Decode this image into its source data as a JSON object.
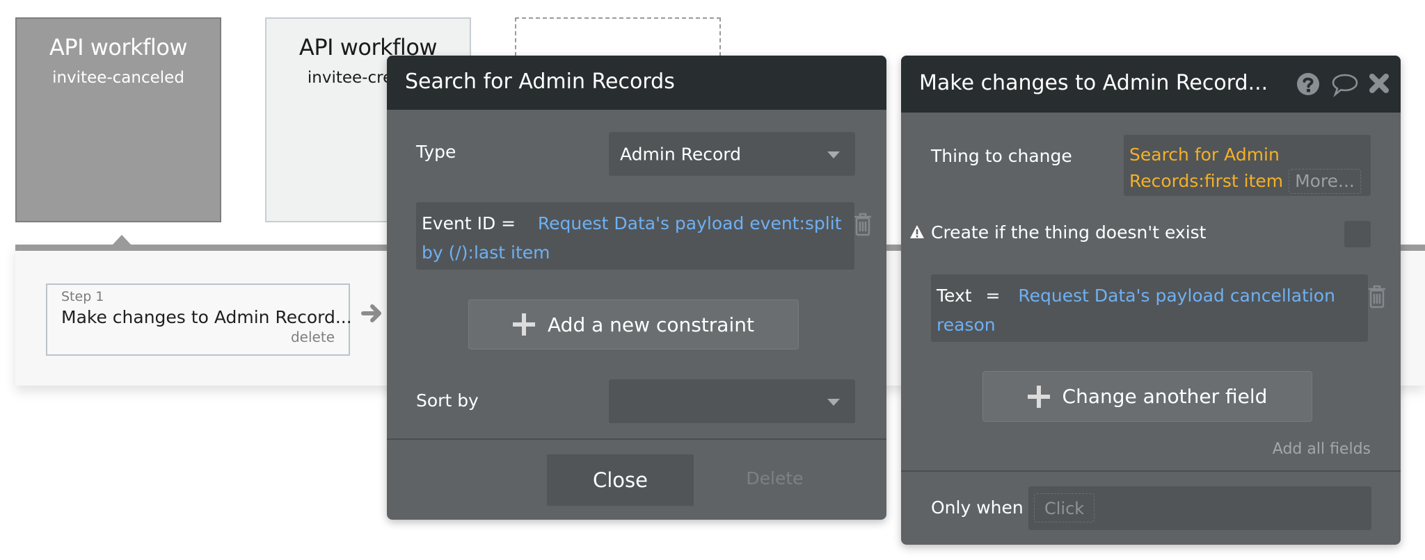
{
  "workflow_cards": [
    {
      "title": "API workflow",
      "subtitle": "invitee-canceled",
      "state": "selected"
    },
    {
      "title": "API workflow",
      "subtitle": "invitee-created",
      "state": "default"
    },
    {
      "title": "",
      "subtitle": "",
      "state": "empty-placeholder"
    }
  ],
  "steps": [
    {
      "step_label": "Step 1",
      "title": "Make changes to Admin Record...",
      "delete_label": "delete"
    }
  ],
  "search_panel": {
    "title": "Search for Admin Records",
    "type_label": "Type",
    "type_value": "Admin Record",
    "constraint": {
      "field": "Event ID =",
      "expression": "Request Data's payload event:split by (/):last item"
    },
    "add_constraint_label": "Add a new constraint",
    "sort_label": "Sort by",
    "sort_value": "",
    "close_label": "Close",
    "delete_label": "Delete"
  },
  "action_panel": {
    "title": "Make changes to Admin Record...",
    "icons": [
      "help-icon",
      "comment-icon",
      "close-icon"
    ],
    "thing_label": "Thing to change",
    "thing_value": "Search for Admin Records:first item",
    "more_label": "More...",
    "create_label": "Create if the thing doesn't exist",
    "create_checked": false,
    "field_change": {
      "field": "Text",
      "operator": "=",
      "expression": "Request Data's payload cancellation reason"
    },
    "change_field_label": "Change another field",
    "add_all_label": "Add all fields",
    "only_when_label": "Only when",
    "only_when_placeholder": "Click"
  },
  "colors": {
    "panel_header": "#282e30",
    "panel_body": "#5f6366",
    "dynamic_expression": "#6fb0f2",
    "thing_expression": "#f5b026"
  }
}
